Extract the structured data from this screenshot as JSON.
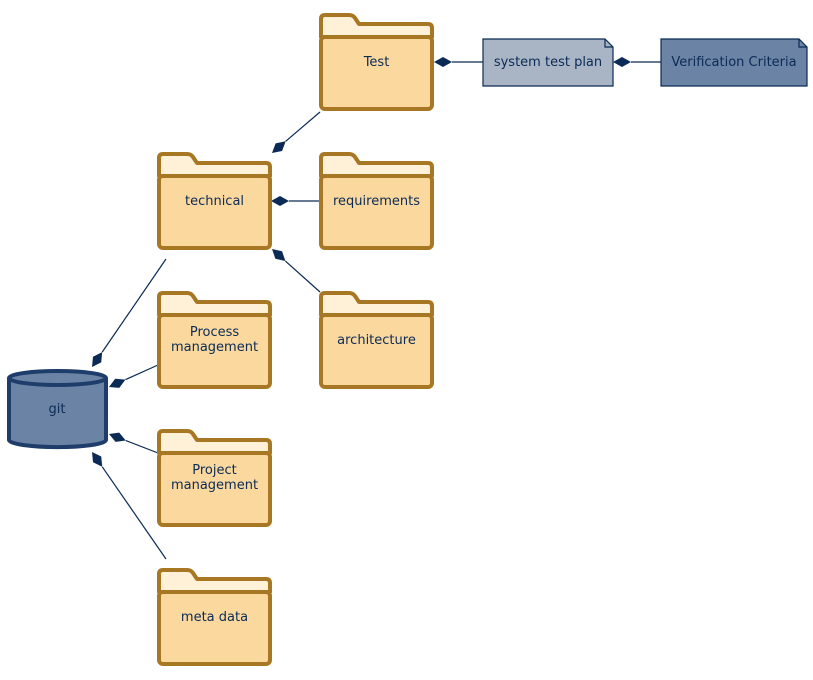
{
  "nodes": {
    "git": {
      "label": "git",
      "type": "database"
    },
    "technical": {
      "label": "technical",
      "type": "folder"
    },
    "test": {
      "label": "Test",
      "type": "folder"
    },
    "requirements": {
      "label": "requirements",
      "type": "folder"
    },
    "architecture": {
      "label": "architecture",
      "type": "folder"
    },
    "process_management": {
      "label_lines": [
        "Process",
        "management"
      ],
      "type": "folder"
    },
    "project_management": {
      "label_lines": [
        "Project",
        "management"
      ],
      "type": "folder"
    },
    "meta_data": {
      "label": "meta data",
      "type": "folder"
    },
    "system_test_plan": {
      "label": "system test plan",
      "type": "document"
    },
    "verification_criteria": {
      "label": "Verification Criteria",
      "type": "document"
    }
  },
  "edges": [
    {
      "from": "git",
      "to": "technical",
      "type": "composition"
    },
    {
      "from": "git",
      "to": "process_management",
      "type": "composition"
    },
    {
      "from": "git",
      "to": "project_management",
      "type": "composition"
    },
    {
      "from": "git",
      "to": "meta_data",
      "type": "composition"
    },
    {
      "from": "technical",
      "to": "test",
      "type": "composition"
    },
    {
      "from": "technical",
      "to": "requirements",
      "type": "composition"
    },
    {
      "from": "technical",
      "to": "architecture",
      "type": "composition"
    },
    {
      "from": "test",
      "to": "system_test_plan",
      "type": "composition"
    },
    {
      "from": "system_test_plan",
      "to": "verification_criteria",
      "type": "composition"
    }
  ],
  "colors": {
    "folder_fill": "#fbd99e",
    "folder_tab": "#fff0d8",
    "folder_stroke": "#a87724",
    "database_fill": "#6b83a4",
    "database_stroke": "#1e3d6b",
    "doc_light": "#a9b5c5",
    "doc_dark": "#6b83a4",
    "edge": "#0b2a55"
  }
}
